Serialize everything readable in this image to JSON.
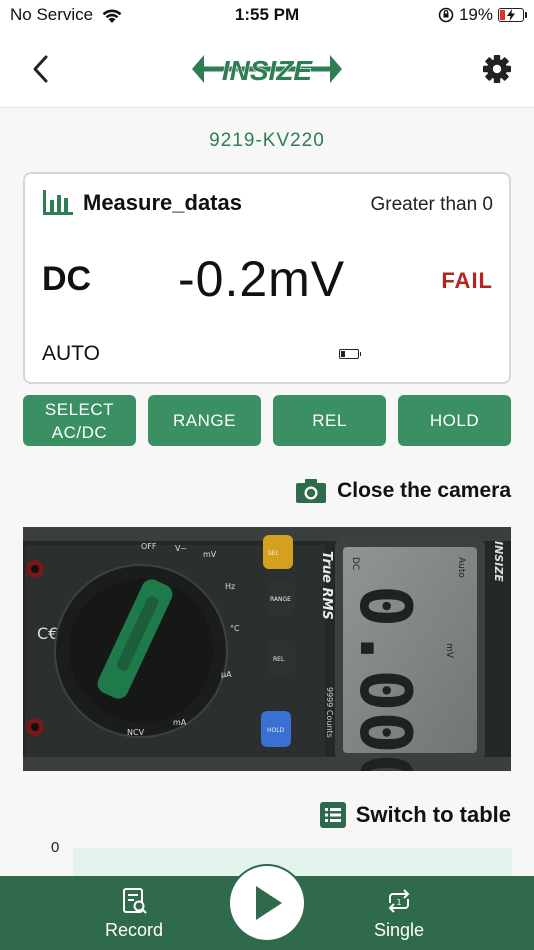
{
  "status_bar": {
    "carrier": "No Service",
    "time": "1:55 PM",
    "battery_percent": "19%",
    "battery_level": 0.19
  },
  "nav": {
    "logo_text": "INSIZE",
    "back_icon": "chevron-left-icon",
    "settings_icon": "gear-icon"
  },
  "device_id": "9219-KV220",
  "measure": {
    "title": "Measure_datas",
    "condition": "Greater than 0",
    "mode": "DC",
    "reading": "-0.2mV",
    "result": "FAIL",
    "range": "AUTO",
    "battery_icon": "battery-low-icon"
  },
  "buttons": [
    {
      "label": "SELECT\nAC/DC"
    },
    {
      "label": "RANGE"
    },
    {
      "label": "REL"
    },
    {
      "label": "HOLD"
    }
  ],
  "camera_toggle": {
    "label": "Close the camera",
    "icon": "camera-icon"
  },
  "camera_feed": {
    "brand": "INSIZE",
    "true_rms": "True RMS",
    "counts": "9999 Counts",
    "keys": [
      "SEL",
      "RANGE",
      "REL",
      "HOLD"
    ],
    "lcd_reading": "0.000",
    "lcd_unit": "mV",
    "lcd_auto": "Auto",
    "lcd_dc": "DC"
  },
  "table_toggle": {
    "label": "Switch to table",
    "icon": "list-icon"
  },
  "chart": {
    "y_tick": "0"
  },
  "tabbar": {
    "record": "Record",
    "single": "Single",
    "play_icon": "play-icon"
  },
  "colors": {
    "brand_green": "#2f7d55",
    "button_green": "#3a8f63",
    "bar_green": "#2e6a4b",
    "fail_red": "#b5251d"
  }
}
